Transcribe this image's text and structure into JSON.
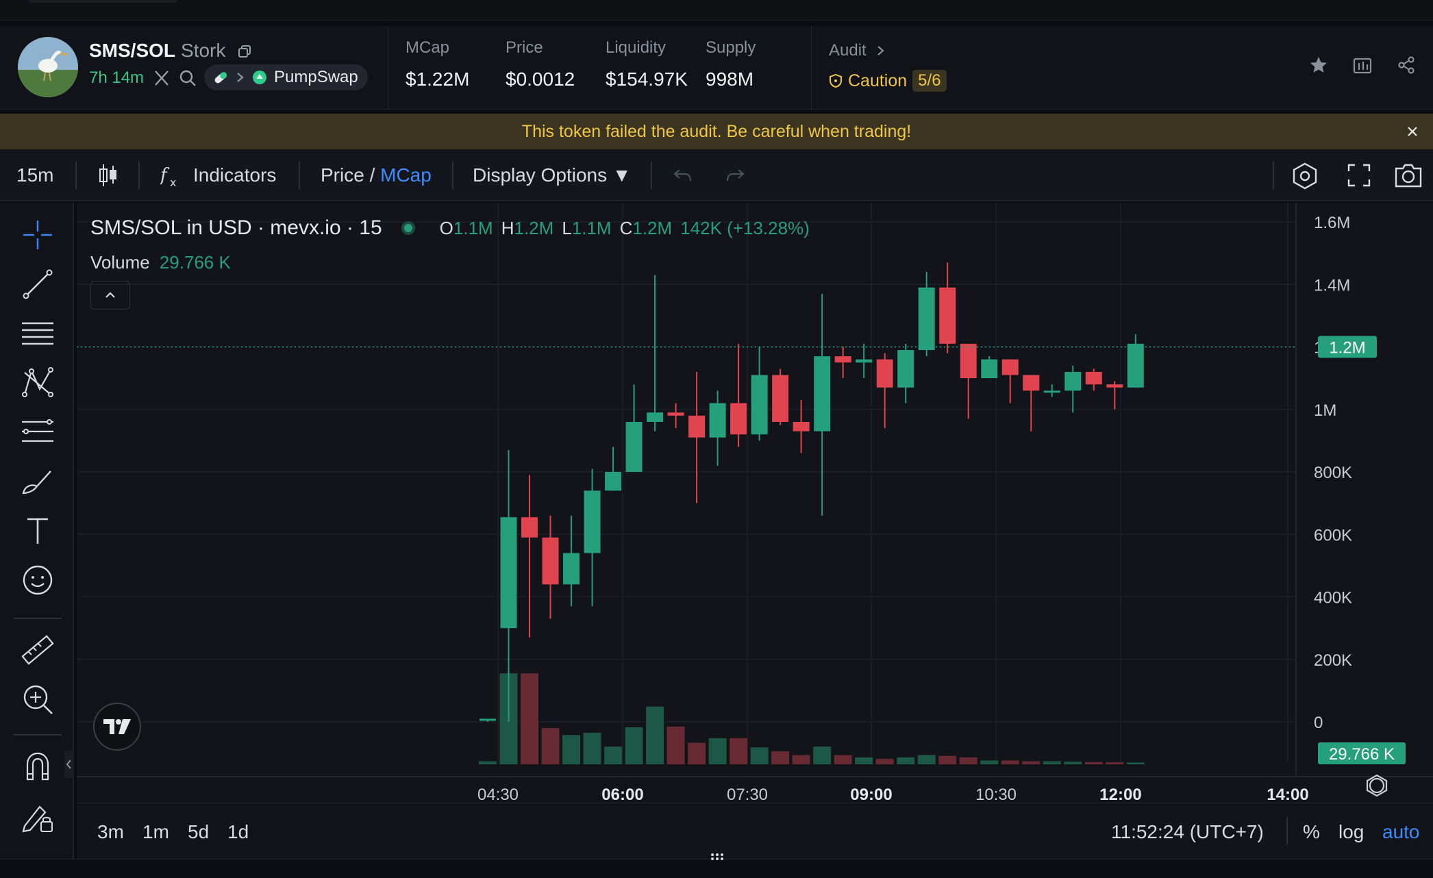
{
  "token": {
    "pair": "SMS/SOL",
    "name": "Stork",
    "age": "7h 14m",
    "dex": "PumpSwap"
  },
  "metrics": [
    {
      "label": "MCap",
      "value": "$1.22M"
    },
    {
      "label": "Price",
      "value": "$0.0012"
    },
    {
      "label": "Liquidity",
      "value": "$154.97K"
    },
    {
      "label": "Supply",
      "value": "998M"
    }
  ],
  "audit": {
    "label": "Audit",
    "status": "Caution",
    "score": "5/6"
  },
  "banner": {
    "text": "This token failed the audit. Be careful when trading!"
  },
  "toolbar": {
    "interval": "15m",
    "indicators": "Indicators",
    "price": "Price",
    "slash": " / ",
    "mcap": "MCap",
    "display_options": "Display Options ▼"
  },
  "legend": {
    "title": "SMS/SOL in USD · mevx.io · 15",
    "o_label": "O",
    "o": "1.1M",
    "h_label": "H",
    "h": "1.2M",
    "l_label": "L",
    "l": "1.1M",
    "c_label": "C",
    "c": "1.2M",
    "change": "142K (+13.28%)",
    "volume_label": "Volume",
    "volume": "29.766 K"
  },
  "bottombar": {
    "ranges": [
      "3m",
      "1m",
      "5d",
      "1d"
    ],
    "clock": "11:52:24 (UTC+7)",
    "percent": "%",
    "log": "log",
    "auto": "auto"
  },
  "colors": {
    "up": "#26a07a",
    "down": "#e0444e",
    "accent": "#3d8bfd",
    "warn": "#f0c645"
  },
  "chart_data": {
    "type": "candlestick",
    "y_ticks": [
      "1.6M",
      "1.4M",
      "1.2M",
      "1M",
      "800K",
      "600K",
      "400K",
      "200K",
      "0"
    ],
    "y_tick_values": [
      1600000,
      1400000,
      1200000,
      1000000,
      800000,
      600000,
      400000,
      200000,
      0
    ],
    "x_ticks": [
      "04:30",
      "06:00",
      "07:30",
      "09:00",
      "10:30",
      "12:00",
      "14:00"
    ],
    "x_ticks_bold": [
      false,
      true,
      false,
      true,
      false,
      true,
      true
    ],
    "ylim": [
      0,
      1600000
    ],
    "last_price_label": "1.2M",
    "last_price": 1200000,
    "volume_label": "29.766 K",
    "candles": [
      {
        "o": 10000,
        "h": 10000,
        "l": 0,
        "c": 10000,
        "v": 20
      },
      {
        "o": 300000,
        "h": 870000,
        "l": 0,
        "c": 655000,
        "v": 590
      },
      {
        "o": 655000,
        "h": 790000,
        "l": 270000,
        "c": 590000,
        "v": 590
      },
      {
        "o": 590000,
        "h": 660000,
        "l": 330000,
        "c": 440000,
        "v": 235
      },
      {
        "o": 440000,
        "h": 660000,
        "l": 370000,
        "c": 540000,
        "v": 190
      },
      {
        "o": 540000,
        "h": 810000,
        "l": 370000,
        "c": 740000,
        "v": 205
      },
      {
        "o": 740000,
        "h": 880000,
        "l": 740000,
        "c": 800000,
        "v": 115
      },
      {
        "o": 800000,
        "h": 1080000,
        "l": 800000,
        "c": 960000,
        "v": 240
      },
      {
        "o": 960000,
        "h": 1430000,
        "l": 930000,
        "c": 990000,
        "v": 375
      },
      {
        "o": 990000,
        "h": 1020000,
        "l": 940000,
        "c": 980000,
        "v": 245
      },
      {
        "o": 980000,
        "h": 1120000,
        "l": 700000,
        "c": 910000,
        "v": 140
      },
      {
        "o": 910000,
        "h": 1060000,
        "l": 820000,
        "c": 1020000,
        "v": 170
      },
      {
        "o": 1020000,
        "h": 1210000,
        "l": 880000,
        "c": 920000,
        "v": 170
      },
      {
        "o": 920000,
        "h": 1200000,
        "l": 900000,
        "c": 1110000,
        "v": 110
      },
      {
        "o": 1110000,
        "h": 1130000,
        "l": 950000,
        "c": 960000,
        "v": 85
      },
      {
        "o": 960000,
        "h": 1030000,
        "l": 860000,
        "c": 930000,
        "v": 60
      },
      {
        "o": 930000,
        "h": 1370000,
        "l": 660000,
        "c": 1170000,
        "v": 115
      },
      {
        "o": 1170000,
        "h": 1200000,
        "l": 1100000,
        "c": 1150000,
        "v": 60
      },
      {
        "o": 1150000,
        "h": 1210000,
        "l": 1100000,
        "c": 1160000,
        "v": 45
      },
      {
        "o": 1160000,
        "h": 1180000,
        "l": 940000,
        "c": 1070000,
        "v": 35
      },
      {
        "o": 1070000,
        "h": 1210000,
        "l": 1020000,
        "c": 1190000,
        "v": 45
      },
      {
        "o": 1190000,
        "h": 1440000,
        "l": 1170000,
        "c": 1390000,
        "v": 60
      },
      {
        "o": 1390000,
        "h": 1470000,
        "l": 1180000,
        "c": 1210000,
        "v": 55
      },
      {
        "o": 1210000,
        "h": 1210000,
        "l": 970000,
        "c": 1100000,
        "v": 45
      },
      {
        "o": 1100000,
        "h": 1170000,
        "l": 1100000,
        "c": 1160000,
        "v": 25
      },
      {
        "o": 1160000,
        "h": 1160000,
        "l": 1020000,
        "c": 1110000,
        "v": 25
      },
      {
        "o": 1110000,
        "h": 1100000,
        "l": 930000,
        "c": 1060000,
        "v": 20
      },
      {
        "o": 1060000,
        "h": 1080000,
        "l": 1040000,
        "c": 1060000,
        "v": 20
      },
      {
        "o": 1060000,
        "h": 1140000,
        "l": 990000,
        "c": 1120000,
        "v": 18
      },
      {
        "o": 1120000,
        "h": 1130000,
        "l": 1060000,
        "c": 1080000,
        "v": 15
      },
      {
        "o": 1080000,
        "h": 1090000,
        "l": 1000000,
        "c": 1070000,
        "v": 14
      },
      {
        "o": 1070000,
        "h": 1240000,
        "l": 1070000,
        "c": 1210000,
        "v": 12
      }
    ]
  }
}
